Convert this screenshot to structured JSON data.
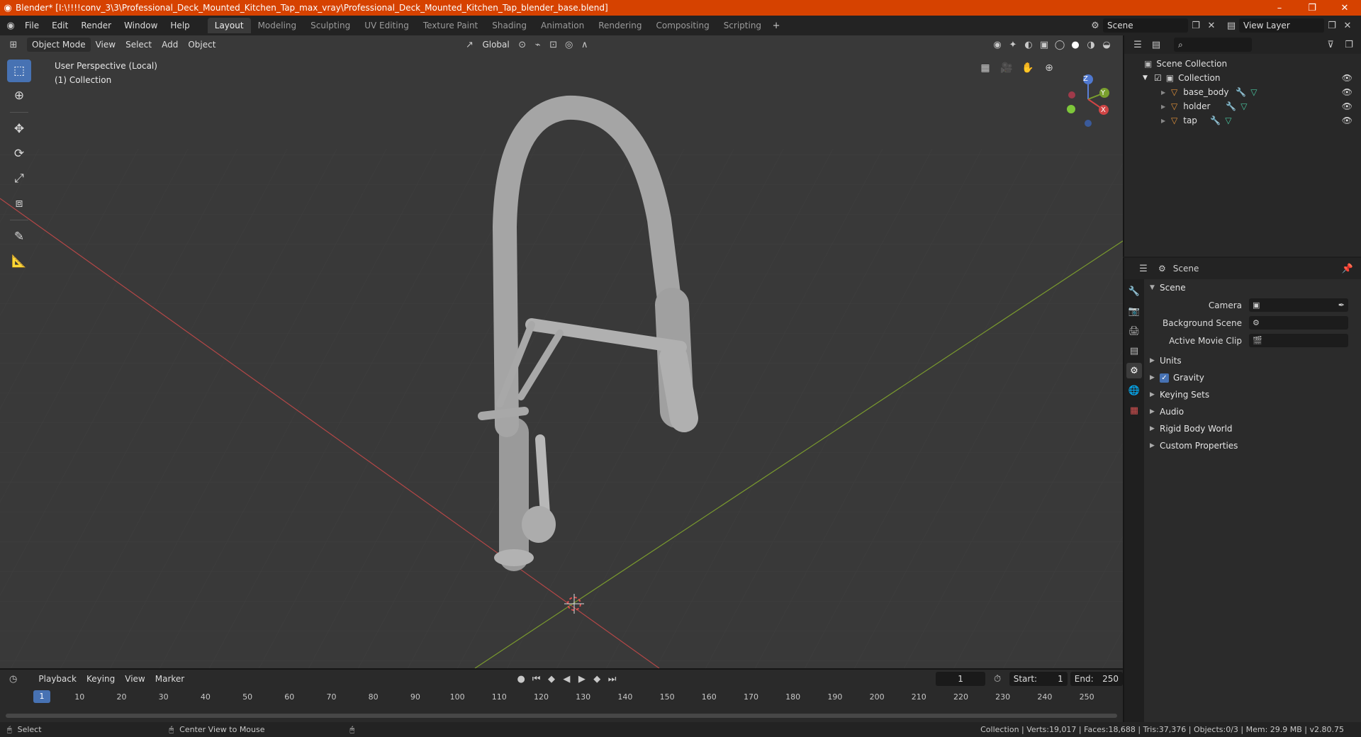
{
  "window": {
    "title": "Blender* [I:\\!!!!conv_3\\3\\Professional_Deck_Mounted_Kitchen_Tap_max_vray\\Professional_Deck_Mounted_Kitchen_Tap_blender_base.blend]",
    "controls": [
      "–",
      "❐",
      "✕"
    ]
  },
  "menu": [
    "File",
    "Edit",
    "Render",
    "Window",
    "Help"
  ],
  "workspaces": [
    "Layout",
    "Modeling",
    "Sculpting",
    "UV Editing",
    "Texture Paint",
    "Shading",
    "Animation",
    "Rendering",
    "Compositing",
    "Scripting"
  ],
  "active_workspace": "Layout",
  "scene_field": "Scene",
  "view_layer_field": "View Layer",
  "viewport": {
    "mode": "Object Mode",
    "menus": [
      "View",
      "Select",
      "Add",
      "Object"
    ],
    "transform_orientation": "Global",
    "overlay_line1": "User Perspective (Local)",
    "overlay_line2": "(1) Collection"
  },
  "gizmo": {
    "z": "Z",
    "y": "Y",
    "x": "X"
  },
  "outliner": {
    "root": "Scene Collection",
    "collection": "Collection",
    "objects": [
      "base_body",
      "holder",
      "tap"
    ]
  },
  "properties": {
    "header": "Scene",
    "panel": "Scene",
    "camera_label": "Camera",
    "background_scene_label": "Background Scene",
    "active_movie_clip_label": "Active Movie Clip",
    "subpanels": [
      "Units",
      "Gravity",
      "Keying Sets",
      "Audio",
      "Rigid Body World",
      "Custom Properties"
    ]
  },
  "timeline": {
    "menus": [
      "Playback",
      "Keying",
      "View",
      "Marker"
    ],
    "current_frame": "1",
    "start_label": "Start:",
    "start_value": "1",
    "end_label": "End:",
    "end_value": "250",
    "ticks": [
      "10",
      "20",
      "30",
      "40",
      "50",
      "60",
      "70",
      "80",
      "90",
      "100",
      "110",
      "120",
      "130",
      "140",
      "150",
      "160",
      "170",
      "180",
      "190",
      "200",
      "210",
      "220",
      "230",
      "240",
      "250"
    ]
  },
  "statusbar": {
    "left": "Select",
    "middle": "Center View to Mouse",
    "right": "Collection | Verts:19,017 | Faces:18,688 | Tris:37,376 | Objects:0/3 | Mem: 29.9 MB | v2.80.75"
  },
  "colors": {
    "titlebar": "#d64200",
    "accent": "#4772b3",
    "grid_x_axis": "#b34747",
    "grid_y_axis": "#7a9a2e",
    "model": "#a8a8a8"
  }
}
